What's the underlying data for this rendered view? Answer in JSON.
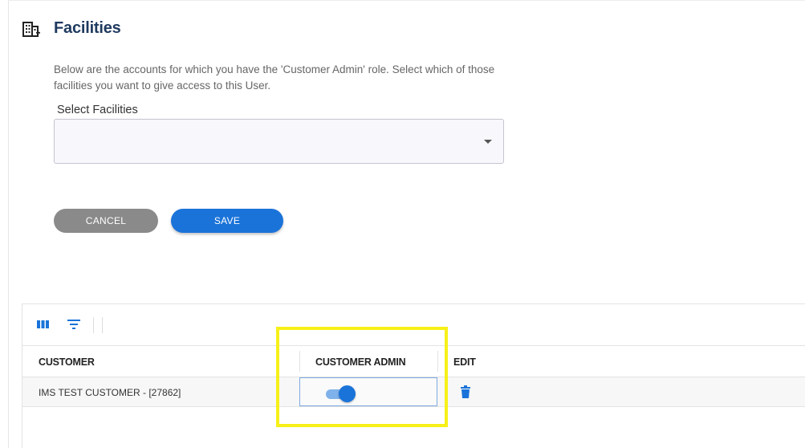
{
  "page": {
    "title": "Facilities",
    "title_icon": "building-add-icon",
    "description": "Below are the accounts for which you have the 'Customer Admin' role. Select which of those facilities you want to give access to this User."
  },
  "form": {
    "select_label": "Select Facilities",
    "select_value": "",
    "cancel_label": "CANCEL",
    "save_label": "SAVE"
  },
  "grid": {
    "toolbar_icons": [
      "columns-icon",
      "filter-icon"
    ],
    "columns": [
      "CUSTOMER",
      "CUSTOMER ADMIN",
      "EDIT"
    ],
    "rows": [
      {
        "customer": "IMS TEST CUSTOMER - [27862]",
        "customer_admin": true,
        "edit_icon": "trash-icon"
      }
    ]
  },
  "colors": {
    "title": "#1f3a5f",
    "primary": "#1a73d9",
    "cancel": "#8a8a8a",
    "highlight": "#f7f018"
  }
}
